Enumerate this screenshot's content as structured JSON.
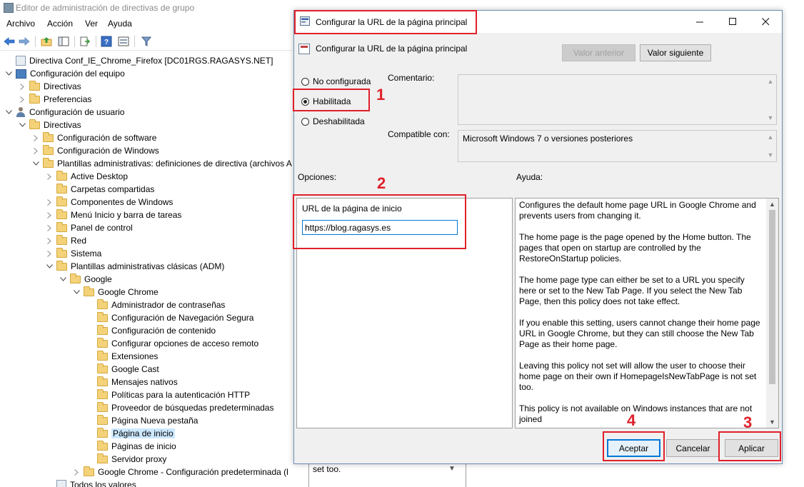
{
  "main": {
    "title": "Editor de administración de directivas de grupo",
    "menu": [
      "Archivo",
      "Acción",
      "Ver",
      "Ayuda"
    ],
    "tree": [
      {
        "label": "Directiva Conf_IE_Chrome_Firefox [DC01RGS.RAGASYS.NET]",
        "icon": "policy-icon",
        "chevron": ""
      },
      {
        "label": "Configuración del equipo",
        "icon": "computer-icon",
        "chevron": "expanded"
      },
      {
        "label": "Directivas",
        "icon": "folder-icon",
        "chevron": "collapsed"
      },
      {
        "label": "Preferencias",
        "icon": "folder-icon",
        "chevron": "collapsed"
      },
      {
        "label": "Configuración de usuario",
        "icon": "user-icon",
        "chevron": "expanded"
      },
      {
        "label": "Directivas",
        "icon": "folder-icon",
        "chevron": "expanded"
      },
      {
        "label": "Configuración de software",
        "icon": "folder-icon",
        "chevron": "collapsed"
      },
      {
        "label": "Configuración de Windows",
        "icon": "folder-icon",
        "chevron": "collapsed"
      },
      {
        "label": "Plantillas administrativas: definiciones de directiva (archivos A",
        "icon": "folder-icon",
        "chevron": "expanded"
      },
      {
        "label": "Active Desktop",
        "icon": "folder-icon",
        "chevron": "collapsed"
      },
      {
        "label": "Carpetas compartidas",
        "icon": "folder-icon",
        "chevron": ""
      },
      {
        "label": "Componentes de Windows",
        "icon": "folder-icon",
        "chevron": "collapsed"
      },
      {
        "label": "Menú Inicio y barra de tareas",
        "icon": "folder-icon",
        "chevron": "collapsed"
      },
      {
        "label": "Panel de control",
        "icon": "folder-icon",
        "chevron": "collapsed"
      },
      {
        "label": "Red",
        "icon": "folder-icon",
        "chevron": "collapsed"
      },
      {
        "label": "Sistema",
        "icon": "folder-icon",
        "chevron": "collapsed"
      },
      {
        "label": "Plantillas administrativas clásicas (ADM)",
        "icon": "folder-icon",
        "chevron": "expanded"
      },
      {
        "label": "Google",
        "icon": "folder-icon",
        "chevron": "expanded"
      },
      {
        "label": "Google Chrome",
        "icon": "folder-icon",
        "chevron": "expanded"
      },
      {
        "label": "Administrador de contraseñas",
        "icon": "folder-icon",
        "chevron": ""
      },
      {
        "label": "Configuración de Navegación Segura",
        "icon": "folder-icon",
        "chevron": ""
      },
      {
        "label": "Configuración de contenido",
        "icon": "folder-icon",
        "chevron": ""
      },
      {
        "label": "Configurar opciones de acceso remoto",
        "icon": "folder-icon",
        "chevron": ""
      },
      {
        "label": "Extensiones",
        "icon": "folder-icon",
        "chevron": ""
      },
      {
        "label": "Google Cast",
        "icon": "folder-icon",
        "chevron": ""
      },
      {
        "label": "Mensajes nativos",
        "icon": "folder-icon",
        "chevron": ""
      },
      {
        "label": "Políticas para la autenticación HTTP",
        "icon": "folder-icon",
        "chevron": ""
      },
      {
        "label": "Proveedor de búsquedas predeterminadas",
        "icon": "folder-icon",
        "chevron": ""
      },
      {
        "label": "Página Nueva pestaña",
        "icon": "folder-icon",
        "chevron": ""
      },
      {
        "label": "Página de inicio",
        "icon": "folder-icon",
        "chevron": "",
        "selected": true
      },
      {
        "label": "Páginas de inicio",
        "icon": "folder-icon",
        "chevron": ""
      },
      {
        "label": "Servidor proxy",
        "icon": "folder-icon",
        "chevron": ""
      },
      {
        "label": "Google Chrome - Configuración predeterminada (l",
        "icon": "folder-icon",
        "chevron": "collapsed"
      },
      {
        "label": "Todos los valores",
        "icon": "policy-icon",
        "chevron": ""
      }
    ],
    "bg_fragment_text": "set too."
  },
  "dialog": {
    "title": "Configurar la URL de la página principal",
    "policy_name": "Configurar la URL de la página principal",
    "prev_button": "Valor anterior",
    "next_button": "Valor siguiente",
    "radio_not_configured": "No configurada",
    "radio_enabled": "Habilitada",
    "radio_disabled": "Deshabilitada",
    "comment_label": "Comentario:",
    "comment_value": "",
    "supported_label": "Compatible con:",
    "supported_value": "Microsoft Windows 7 o versiones posteriores",
    "options_label": "Opciones:",
    "help_label": "Ayuda:",
    "url_field_label": "URL de la página de inicio",
    "url_field_value": "https://blog.ragasys.es",
    "help_paragraphs": [
      "Configures the default home page URL in Google Chrome and prevents users from changing it.",
      "The home page is the page opened by the Home button. The pages that open on startup are controlled by the RestoreOnStartup policies.",
      "The home page type can either be set to a URL you specify here or set to the New Tab Page. If you select the New Tab Page, then this policy does not take effect.",
      "If you enable this setting, users cannot change their home page URL in Google Chrome, but they can still choose the New Tab Page as their home page.",
      "Leaving this policy not set will allow the user to choose their home page on their own if HomepageIsNewTabPage is not set too.",
      "This policy is not available on Windows instances that are not joined"
    ],
    "ok_button": "Aceptar",
    "cancel_button": "Cancelar",
    "apply_button": "Aplicar"
  },
  "annotations": {
    "step1": "1",
    "step2": "2",
    "step3": "3",
    "step4": "4",
    "color": "#e0202a"
  }
}
